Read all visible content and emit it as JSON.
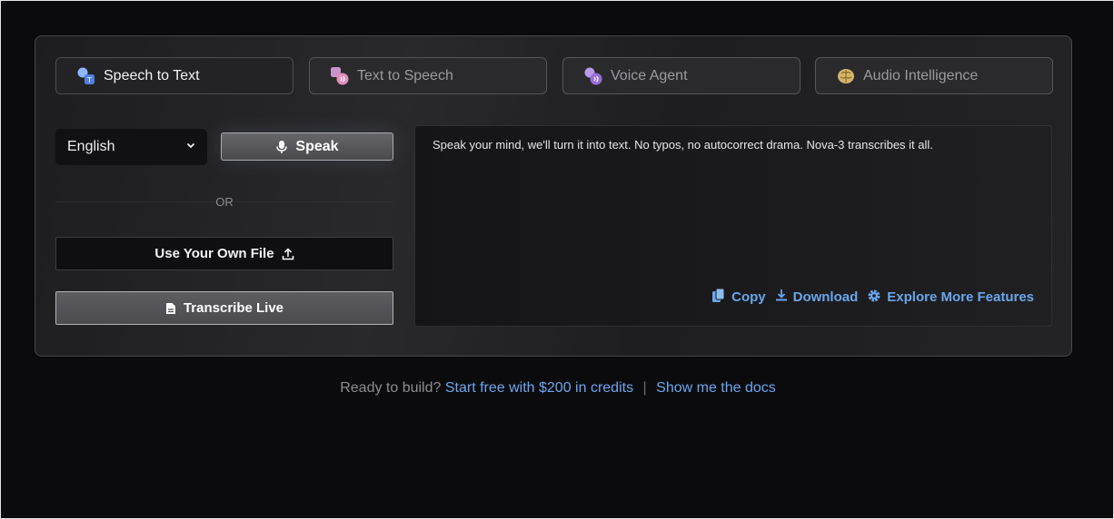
{
  "tabs": [
    {
      "label": "Speech to Text",
      "icon": "speech-to-text-icon",
      "active": true
    },
    {
      "label": "Text to Speech",
      "icon": "text-to-speech-icon",
      "active": false
    },
    {
      "label": "Voice Agent",
      "icon": "voice-agent-icon",
      "active": false
    },
    {
      "label": "Audio Intelligence",
      "icon": "audio-intelligence-icon",
      "active": false
    }
  ],
  "controls": {
    "language": "English",
    "speak_label": "Speak",
    "or_label": "OR",
    "own_file_label": "Use Your Own File",
    "transcribe_live_label": "Transcribe Live"
  },
  "output": {
    "text": "Speak your mind, we'll turn it into text. No typos, no autocorrect drama. Nova-3 transcribes it all.",
    "copy_label": "Copy",
    "download_label": "Download",
    "explore_label": "Explore More Features"
  },
  "footer": {
    "prompt": "Ready to build?",
    "start_link": "Start free with $200 in credits",
    "separator": "|",
    "docs_link": "Show me the docs"
  },
  "colors": {
    "accent_link": "#6aa6ea",
    "background": "#0b0b0d"
  }
}
